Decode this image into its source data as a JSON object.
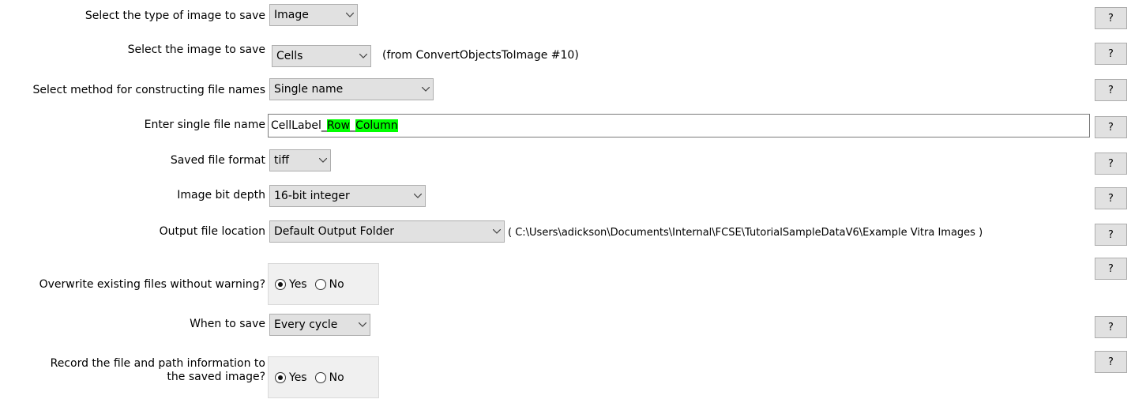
{
  "rows": [
    {
      "label": "Select the type of image to save",
      "value": "Image"
    },
    {
      "label": "Select the image to save",
      "value": "Cells",
      "note": "(from ConvertObjectsToImage #10)"
    },
    {
      "label": "Select method for constructing file names",
      "value": "Single name"
    },
    {
      "label": "Enter single file name",
      "parts": [
        "CellLabel_",
        "Row",
        "_",
        "Column"
      ]
    },
    {
      "label": "Saved file format",
      "value": "tiff"
    },
    {
      "label": "Image bit depth",
      "value": "16-bit integer"
    },
    {
      "label": "Output file location",
      "value": "Default Output Folder",
      "note": "( C:\\Users\\adickson\\Documents\\Internal\\FCSE\\TutorialSampleDataV6\\Example Vitra Images )"
    },
    {
      "label": "Overwrite existing files without warning?",
      "options": [
        "Yes",
        "No"
      ],
      "selected": "Yes"
    },
    {
      "label": "When to save",
      "value": "Every cycle"
    },
    {
      "label_line1": "Record the file and path information to",
      "label_line2": "the saved image?",
      "options": [
        "Yes",
        "No"
      ],
      "selected": "Yes"
    }
  ],
  "help_label": "?"
}
